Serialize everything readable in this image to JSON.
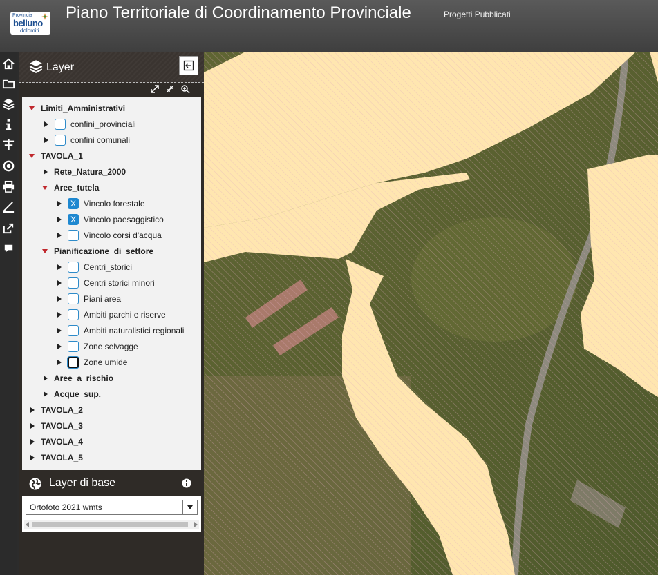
{
  "header": {
    "logo": {
      "line1": "Provincia",
      "line2": "belluno",
      "line3": "dolomiti"
    },
    "title": "Piano Territoriale di Coordinamento Provinciale",
    "subtitle": "Progetti Pubblicati"
  },
  "toolbar": {
    "icons": [
      "home-icon",
      "folder-icon",
      "layers-icon",
      "info-icon",
      "measure-icon",
      "target-icon",
      "print-icon",
      "ruler-icon",
      "share-icon",
      "chat-icon"
    ]
  },
  "layer_panel": {
    "title": "Layer",
    "tree": [
      {
        "label": "Limiti_Amministrativi",
        "expanded": true
      },
      {
        "label": "confini_provinciali",
        "checked": false
      },
      {
        "label": "confini comunali",
        "checked": false
      },
      {
        "label": "TAVOLA_1",
        "expanded": true
      },
      {
        "label": "Rete_Natura_2000",
        "expanded": false
      },
      {
        "label": "Aree_tutela",
        "expanded": true
      },
      {
        "label": "Vincolo forestale",
        "checked": true
      },
      {
        "label": "Vincolo paesaggistico",
        "checked": true
      },
      {
        "label": "Vincolo corsi d'acqua",
        "checked": false
      },
      {
        "label": "Pianificazione_di_settore",
        "expanded": true
      },
      {
        "label": "Centri_storici",
        "checked": false
      },
      {
        "label": "Centri storici minori",
        "checked": false
      },
      {
        "label": "Piani area",
        "checked": false
      },
      {
        "label": "Ambiti parchi e riserve",
        "checked": false
      },
      {
        "label": "Ambiti naturalistici regionali",
        "checked": false
      },
      {
        "label": "Zone selvagge",
        "checked": false
      },
      {
        "label": "Zone umide",
        "checked": false
      },
      {
        "label": "Aree_a_rischio",
        "expanded": false
      },
      {
        "label": "Acque_sup.",
        "expanded": false
      },
      {
        "label": "TAVOLA_2",
        "expanded": false
      },
      {
        "label": "TAVOLA_3",
        "expanded": false
      },
      {
        "label": "TAVOLA_4",
        "expanded": false
      },
      {
        "label": "TAVOLA_5",
        "expanded": false
      }
    ],
    "checkmark": "X"
  },
  "base_layer": {
    "title": "Layer di base",
    "selected": "Ortofoto 2021 wmts"
  },
  "colors": {
    "accent": "#1f88d0",
    "open_arrow": "#c0282d",
    "overlay": "#ffe6b0"
  }
}
